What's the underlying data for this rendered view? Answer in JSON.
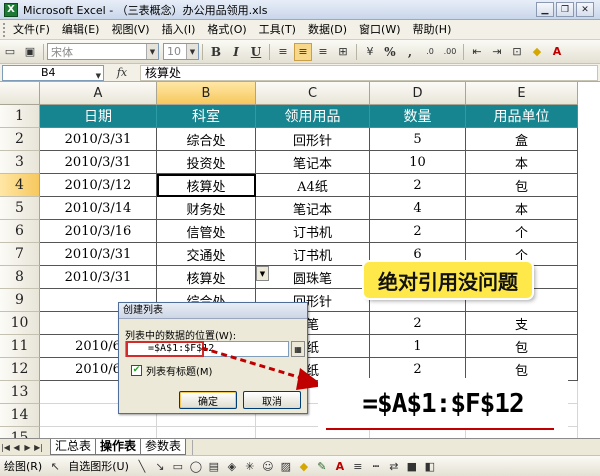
{
  "window": {
    "title": "Microsoft Excel - （三表概念）办公用品领用.xls",
    "app_icon": "X"
  },
  "menu": {
    "items": [
      "文件(F)",
      "编辑(E)",
      "视图(V)",
      "插入(I)",
      "格式(O)",
      "工具(T)",
      "数据(D)",
      "窗口(W)",
      "帮助(H)"
    ]
  },
  "toolbar": {
    "font_name": "宋体",
    "font_size": "10",
    "bold": "B",
    "italic": "I",
    "underline": "U",
    "percent": "%",
    "comma": ","
  },
  "formula_bar": {
    "name_box": "B4",
    "fx": "fx",
    "content": "核算处"
  },
  "grid": {
    "columns": [
      "A",
      "B",
      "C",
      "D",
      "E"
    ],
    "rows": [
      "1",
      "2",
      "3",
      "4",
      "5",
      "6",
      "7",
      "8",
      "9",
      "10",
      "11",
      "12",
      "13",
      "14",
      "15"
    ],
    "header": [
      "日期",
      "科室",
      "领用用品",
      "数量",
      "用品单位"
    ],
    "data": [
      [
        "2010/3/31",
        "综合处",
        "回形针",
        "5",
        "盒"
      ],
      [
        "2010/3/31",
        "投资处",
        "笔记本",
        "10",
        "本"
      ],
      [
        "2010/3/12",
        "核算处",
        "A4纸",
        "2",
        "包"
      ],
      [
        "2010/3/14",
        "财务处",
        "笔记本",
        "4",
        "本"
      ],
      [
        "2010/3/16",
        "信管处",
        "订书机",
        "2",
        "个"
      ],
      [
        "2010/3/31",
        "交通处",
        "订书机",
        "6",
        "个"
      ],
      [
        "2010/3/31",
        "核算处",
        "圆珠笔",
        "",
        ""
      ],
      [
        "",
        "综合处",
        "回形针",
        "",
        ""
      ],
      [
        "",
        "",
        "笔",
        "2",
        "支"
      ],
      [
        "2010/6",
        "",
        "纸",
        "1",
        "包"
      ],
      [
        "2010/6",
        "",
        "纸",
        "2",
        "包"
      ]
    ]
  },
  "dialog": {
    "title": "创建列表",
    "label": "列表中的数据的位置(W):",
    "range_value": "=$A$1:$F$12",
    "checkbox_label": "列表有标题(M)",
    "checkbox_checked": true,
    "ok_label": "确定",
    "cancel_label": "取消"
  },
  "callout": {
    "text": "绝对引用没问题",
    "formula": "=$A$1:$F$12"
  },
  "sheet_tabs": [
    "汇总表",
    "操作表",
    "参数表"
  ],
  "draw_toolbar": {
    "draw_label": "绘图(R)",
    "autoshape_label": "自选图形(U)"
  },
  "colors": {
    "header_fill": "#17858f",
    "callout_fill": "#ffe94a",
    "highlight": "#d12b2b"
  }
}
